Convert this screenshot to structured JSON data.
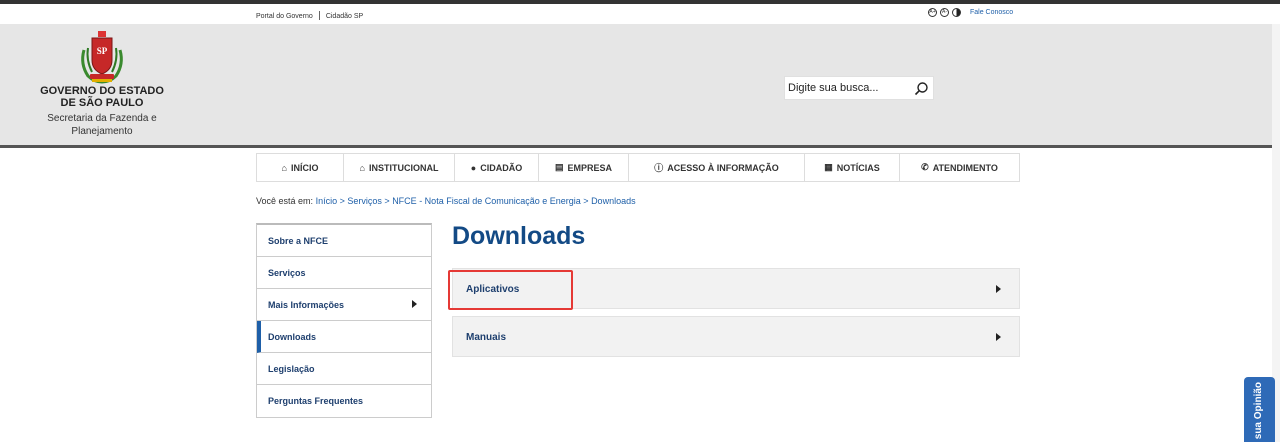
{
  "utility": {
    "portal_link": "Portal do Governo",
    "cidadao_link": "Cidadão SP",
    "fale_conosco": "Fale Conosco"
  },
  "header": {
    "title_line1": "GOVERNO DO ESTADO",
    "title_line2": "DE SÃO PAULO",
    "subtitle_line1": "Secretaria da Fazenda e",
    "subtitle_line2": "Planejamento",
    "search_placeholder": "Digite sua busca..."
  },
  "nav": {
    "items": [
      {
        "label": "INÍCIO",
        "icon": "home-icon"
      },
      {
        "label": "INSTITUCIONAL",
        "icon": "institution-icon"
      },
      {
        "label": "CIDADÃO",
        "icon": "user-icon"
      },
      {
        "label": "EMPRESA",
        "icon": "factory-icon"
      },
      {
        "label": "ACESSO À INFORMAÇÃO",
        "icon": "info-icon"
      },
      {
        "label": "NOTÍCIAS",
        "icon": "newspaper-icon"
      },
      {
        "label": "ATENDIMENTO",
        "icon": "phone-icon"
      }
    ]
  },
  "breadcrumb": {
    "prefix": "Você está em:",
    "items": [
      "Início",
      "Serviços",
      "NFCE - Nota Fiscal de Comunicação e Energia",
      "Downloads"
    ],
    "separator": ">"
  },
  "sidebar": {
    "items": [
      {
        "label": "Sobre a NFCE"
      },
      {
        "label": "Serviços"
      },
      {
        "label": "Mais Informações"
      },
      {
        "label": "Downloads"
      },
      {
        "label": "Legislação"
      },
      {
        "label": "Perguntas Frequentes"
      }
    ]
  },
  "main": {
    "title": "Downloads",
    "sections": [
      {
        "label": "Aplicativos"
      },
      {
        "label": "Manuais"
      }
    ]
  },
  "feedback": {
    "label": "Dê sua Opinião"
  },
  "colors": {
    "link_blue": "#1e5fa8",
    "title_blue": "#134a85",
    "highlight_red": "#e53935",
    "feedback_blue": "#2e6ab7",
    "header_gray": "#e6e6e6"
  }
}
